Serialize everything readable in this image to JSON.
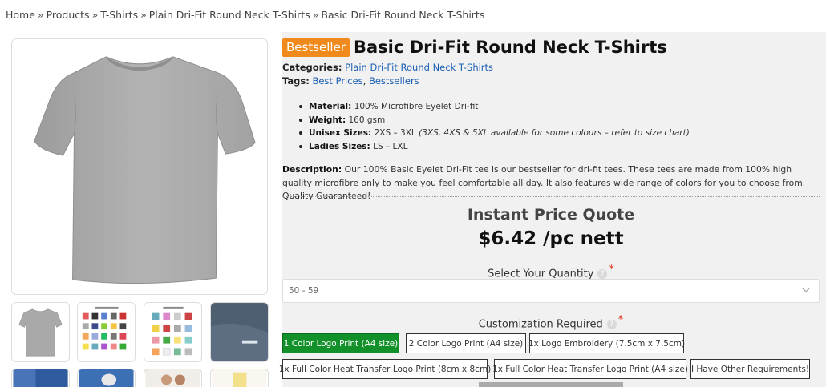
{
  "breadcrumb": {
    "items": [
      "Home",
      "Products",
      "T-Shirts",
      "Plain Dri-Fit Round Neck T-Shirts",
      "Basic Dri-Fit Round Neck T-Shirts"
    ],
    "separator": "»"
  },
  "product": {
    "badge": "Bestseller",
    "title": "Basic Dri-Fit Round Neck T-Shirts",
    "categories_label": "Categories:",
    "category": "Plain Dri-Fit Round Neck T-Shirts",
    "tags_label": "Tags:",
    "tags": [
      "Best Prices",
      "Bestsellers"
    ],
    "tag_separator": ","
  },
  "specs": [
    {
      "label": "Material:",
      "value": "100% Microfibre Eyelet Dri-fit",
      "note": ""
    },
    {
      "label": "Weight:",
      "value": "160 gsm",
      "note": ""
    },
    {
      "label": "Unisex Sizes:",
      "value": "2XS – 3XL",
      "note": "(3XS, 4XS & 5XL available for some colours – refer to size chart)"
    },
    {
      "label": "Ladies Sizes:",
      "value": "LS – LXL",
      "note": ""
    }
  ],
  "description": {
    "label": "Description:",
    "text": "Our 100% Basic Eyelet Dri-Fit tee is our bestseller for dri-fit tees. These tees are made from 100% high quality microfibre only to make you feel comfortable all day. It also features wide range of colors for you to choose from. Quality Guaranteed!"
  },
  "quote": {
    "title": "Instant Price Quote",
    "price": "$6.42 /pc nett"
  },
  "quantity": {
    "label": "Select Your Quantity",
    "help_glyph": "?",
    "required_mark": "*",
    "selected": "50 - 59"
  },
  "customization": {
    "label": "Customization Required",
    "help_glyph": "?",
    "required_mark": "*",
    "options": [
      "1 Color Logo Print (A4 size)",
      "2 Color Logo Print (A4 size)",
      "1x Logo Embroidery (7.5cm x 7.5cm)",
      "1x Full Color Heat Transfer Logo Print (8cm x 8cm)",
      "1x Full Color Heat Transfer Logo Print (A4 size)",
      "I Have Other Requirements!"
    ],
    "active_index": 0
  },
  "colors": {
    "badge": "#f08a1c",
    "link": "#1a5fb4",
    "active_option": "#12902a",
    "required": "#e0311f",
    "shirt": "#a9a9a9"
  }
}
